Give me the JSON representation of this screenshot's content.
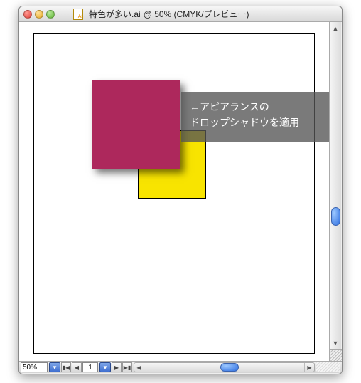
{
  "window": {
    "title_filename": "特色が多い.ai",
    "title_suffix": " @ 50% (CMYK/プレビュー)"
  },
  "annotation": {
    "line1": "←アピアランスの",
    "line2": "ドロップシャドウを適用"
  },
  "statusbar": {
    "zoom": "50%",
    "page": "1"
  },
  "colors": {
    "magenta_square": "#ad285c",
    "yellow_square": "#f8e400"
  }
}
